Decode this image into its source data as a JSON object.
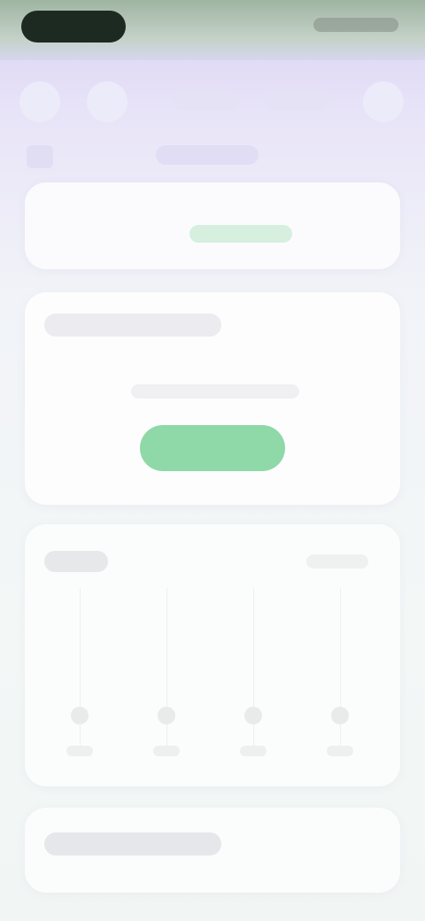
{
  "colors": {
    "accent_green": "#8fd8a8",
    "background_top": "#d9d3f3",
    "background_bottom": "#f1f5f4"
  },
  "icons": {
    "nav_left": "back-icon",
    "nav_right": "more-icon",
    "sub_row": "calendar-icon"
  },
  "chart": {
    "columns": 4
  }
}
